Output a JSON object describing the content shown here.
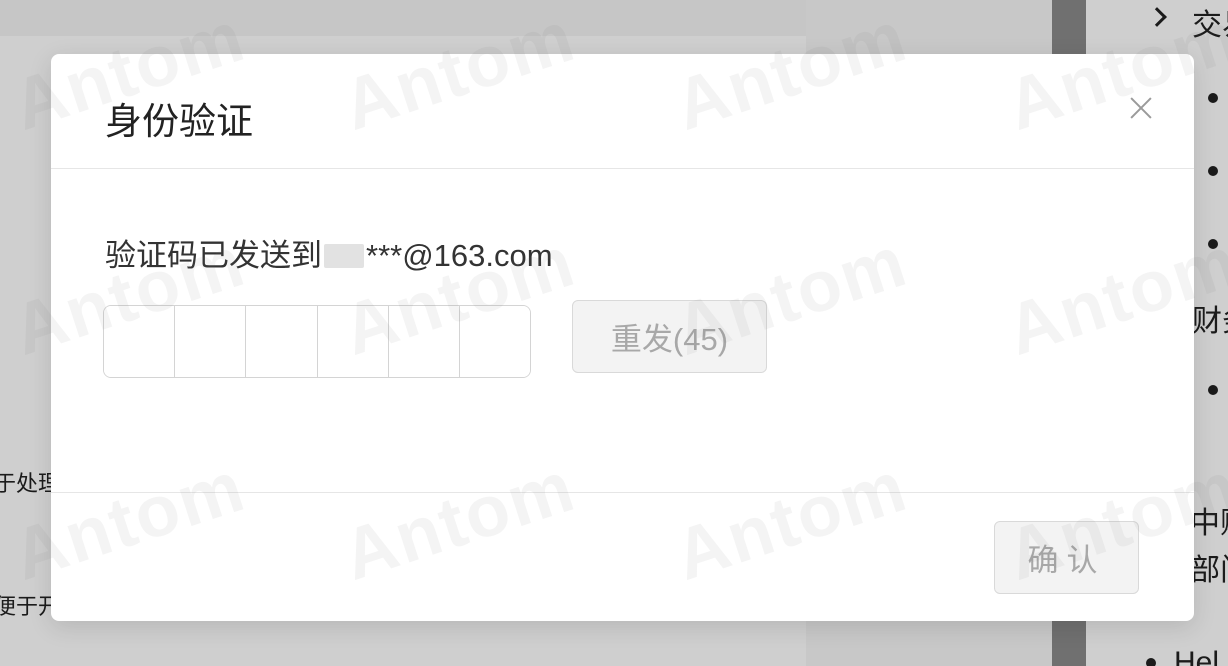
{
  "background": {
    "left_text_1": "于处理",
    "left_text_2": "便于开",
    "right_title": "交易",
    "right_text_1": "财务",
    "right_text_2": "中账",
    "right_text_3": "部门",
    "right_text_4": "Hel"
  },
  "dialog": {
    "title": "身份验证",
    "close_label": "×",
    "sent_prefix": "验证码已发送到",
    "email_masked_suffix": "***@163.com",
    "code_length": 6,
    "resend_label": "重发(45)",
    "confirm_label": "确认"
  },
  "watermark": {
    "text": "Antom"
  },
  "colors": {
    "overlay": "#000000",
    "disabled_text": "#a8a8a8",
    "disabled_bg": "#f3f3f3"
  }
}
